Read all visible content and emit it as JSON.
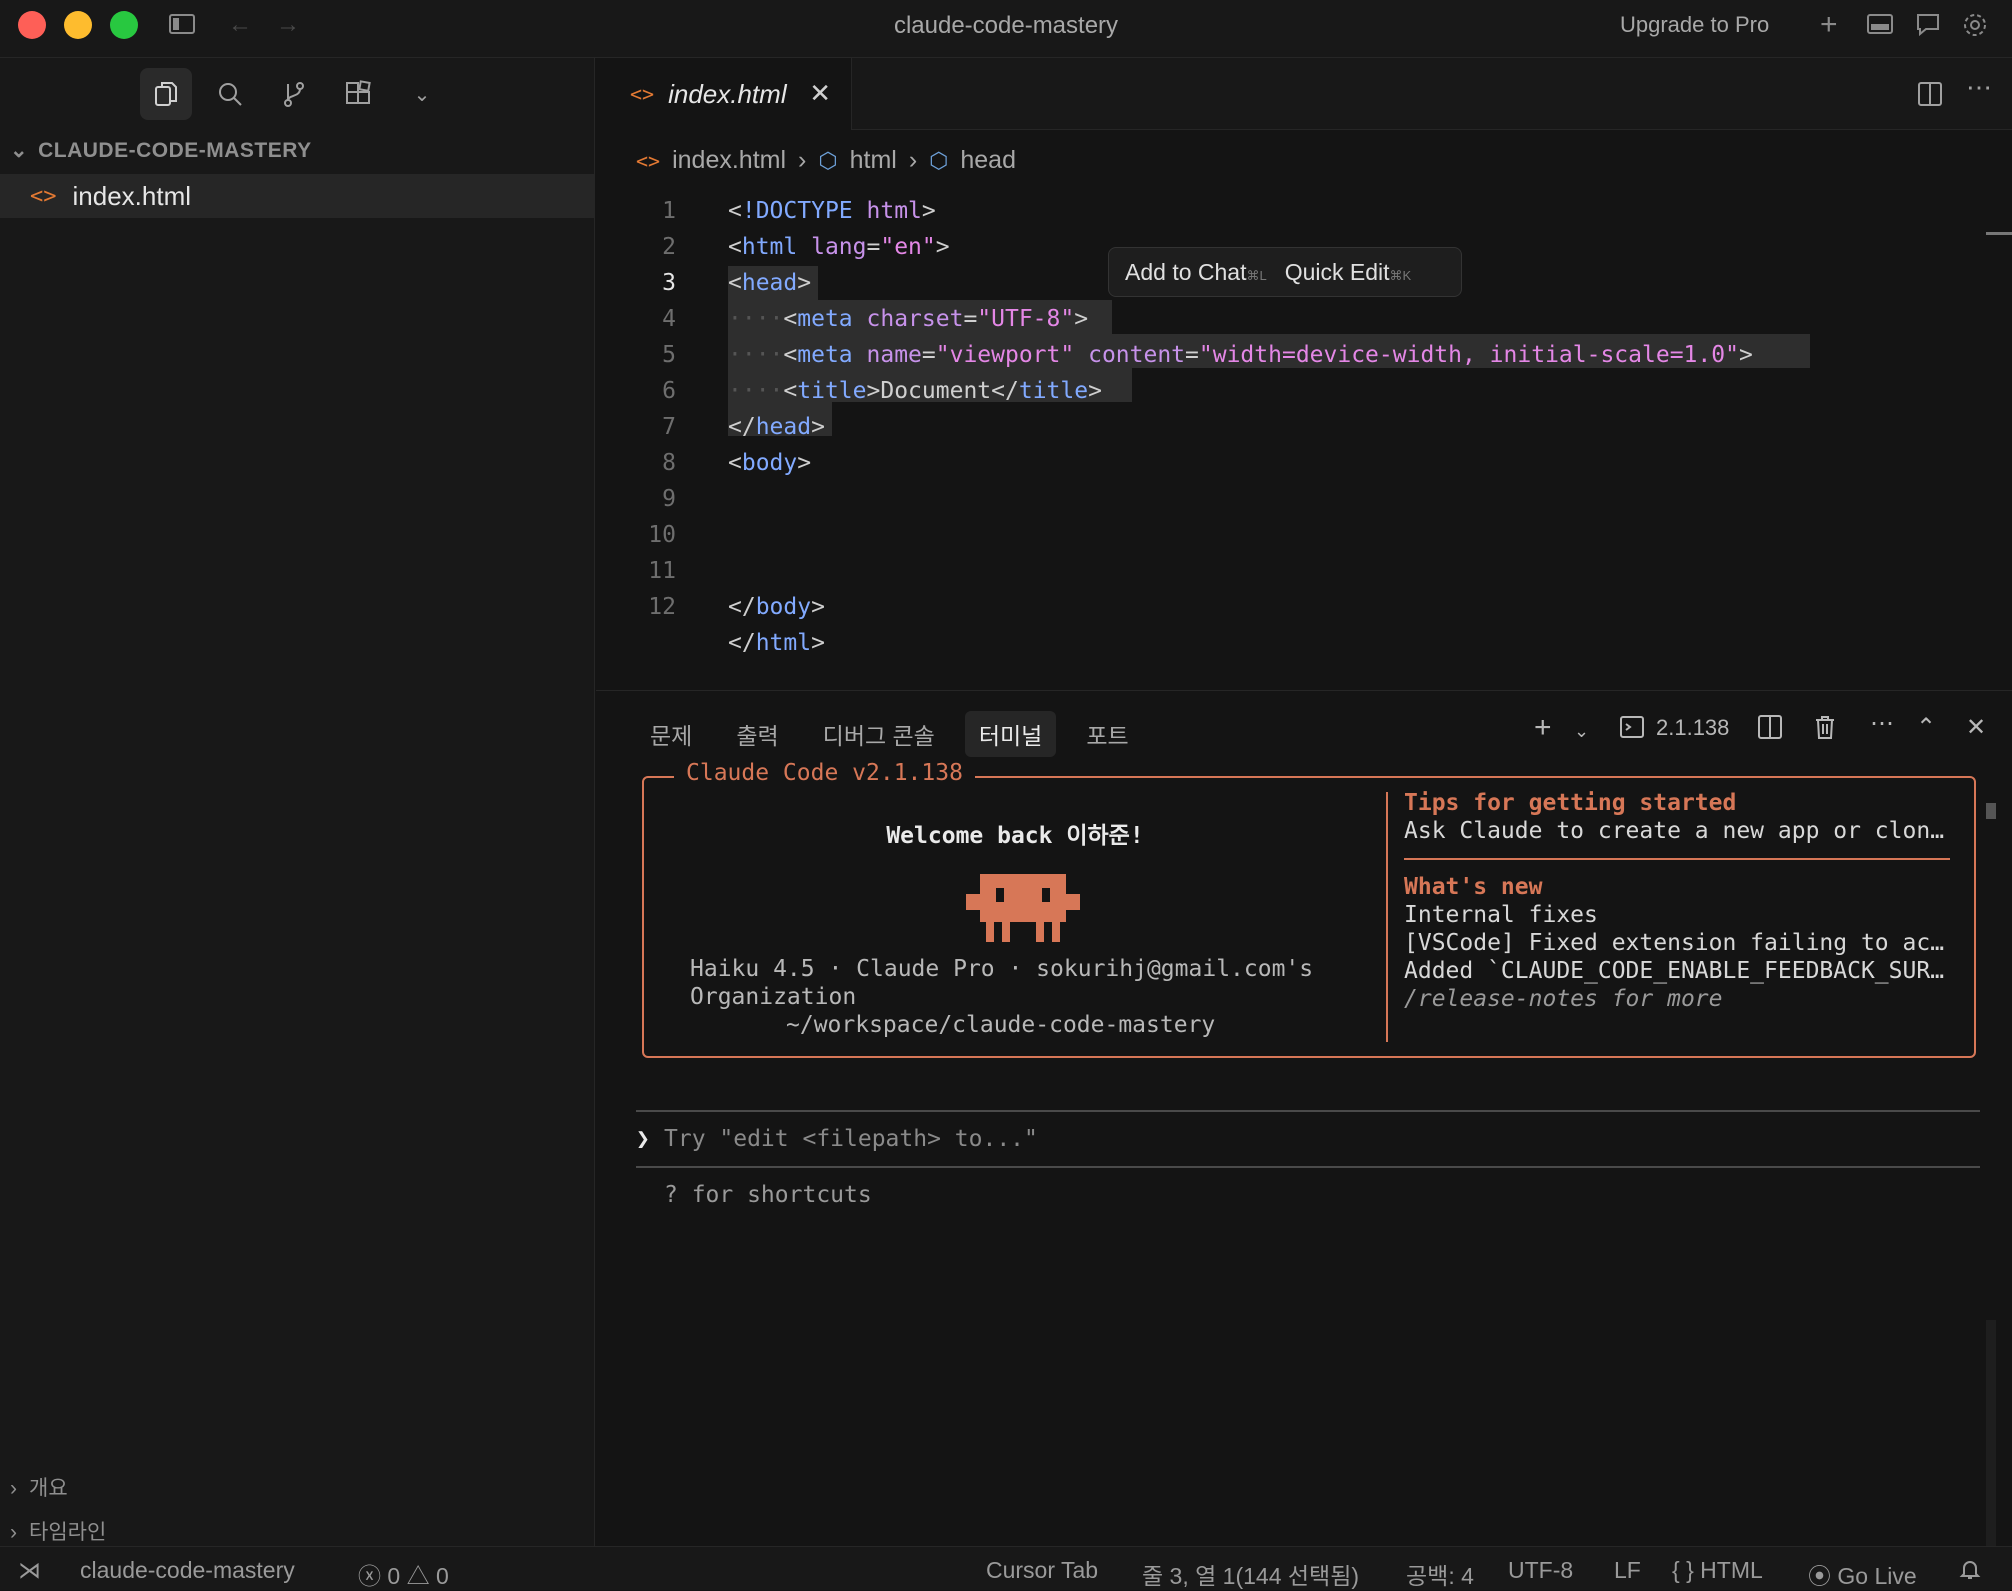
{
  "window": {
    "title": "claude-code-mastery",
    "upgrade": "Upgrade to Pro"
  },
  "sidebar": {
    "section": "CLAUDE-CODE-MASTERY",
    "file": "index.html",
    "bottom": [
      "개요",
      "타임라인"
    ]
  },
  "editor": {
    "tab": "index.html",
    "breadcrumb": [
      "index.html",
      "html",
      "head"
    ],
    "popup": {
      "add": "Add to Chat",
      "add_key": "⌘L",
      "edit": "Quick Edit",
      "edit_key": "⌘K"
    },
    "line_numbers": [
      "1",
      "2",
      "3",
      "4",
      "5",
      "6",
      "7",
      "8",
      "9",
      "10",
      "11",
      "12"
    ]
  },
  "panel": {
    "tabs": [
      "문제",
      "출력",
      "디버그 콘솔",
      "터미널",
      "포트"
    ],
    "terminal_name": "2.1.138",
    "box_title": "Claude Code v2.1.138",
    "welcome": "Welcome back 이하준!",
    "model": "Haiku 4.5 · Claude Pro · sokurihj@gmail.com's",
    "org": "Organization",
    "path": "~/workspace/claude-code-mastery",
    "tips_title": "Tips for getting started",
    "tips_text": "Ask Claude to create a new app or clon…",
    "new_title": "What's new",
    "new_items": [
      "Internal fixes",
      "[VSCode] Fixed extension failing to ac…",
      "Added `CLAUDE_CODE_ENABLE_FEEDBACK_SUR…"
    ],
    "release": "/release-notes for more",
    "prompt": "Try \"edit <filepath> to...\"",
    "hint": "? for shortcuts"
  },
  "status": {
    "branch": "claude-code-mastery",
    "errors": "0",
    "warnings": "0",
    "cursor_tab": "Cursor Tab",
    "position": "줄 3, 열 1(144 선택됨)",
    "spaces": "공백: 4",
    "encoding": "UTF-8",
    "eol": "LF",
    "lang": "HTML",
    "golive": "Go Live"
  }
}
